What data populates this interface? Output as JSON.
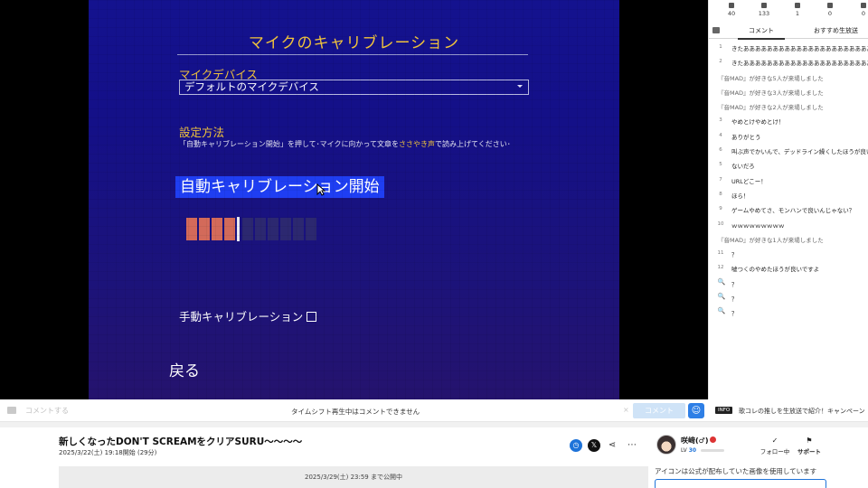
{
  "game": {
    "title": "マイクのキャリブレーション",
    "device_label": "マイクデバイス",
    "device_value": "デフォルトのマイクデバイス",
    "method_label": "設定方法",
    "desc_a": "「自動キャリブレーション開始」を押して･マイクに向かって文章を",
    "desc_hl": "ささやき声",
    "desc_b": "で読み上げてください･",
    "auto_button": "自動キャリブレーション開始",
    "meter_level": 0.4,
    "manual_label": "手動キャリブレーション",
    "back_label": "戻る"
  },
  "comment_bar": {
    "placeholder": "コメントする",
    "notice": "タイムシフト再生中はコメントできません",
    "submit_label": "コメント",
    "clear_label": "×"
  },
  "stats": [
    {
      "icon": "viewers-icon",
      "value": "40"
    },
    {
      "icon": "comments-icon",
      "value": "133"
    },
    {
      "icon": "ad-icon",
      "value": "1"
    },
    {
      "icon": "gift-icon",
      "value": "0"
    },
    {
      "icon": "present-icon",
      "value": "0"
    }
  ],
  "tabs": {
    "comments": "コメント",
    "recommended": "おすすめ生放送"
  },
  "comments": [
    {
      "num": "1",
      "text": "きたあああああああああああああああああああああああああああ"
    },
    {
      "num": "2",
      "text": "きたあああああああああああああああああああああああああああ"
    },
    {
      "num": "",
      "text": "『音MAD』が好きな5人が来場しました",
      "sys": true
    },
    {
      "num": "",
      "text": "『音MAD』が好きな3人が来場しました",
      "sys": true
    },
    {
      "num": "",
      "text": "『音MAD』が好きな2人が来場しました",
      "sys": true
    },
    {
      "num": "3",
      "text": "やめとけやめとけ！"
    },
    {
      "num": "4",
      "text": "ありがとう"
    },
    {
      "num": "6",
      "text": "叫ぶ声でかいんで、デッドライン繰くしたほうが良いで"
    },
    {
      "num": "5",
      "text": "ないだろ"
    },
    {
      "num": "7",
      "text": "URLどこー！"
    },
    {
      "num": "8",
      "text": "ほら！"
    },
    {
      "num": "9",
      "text": "ゲームやめてさ、モンハンで良いんじゃない？"
    },
    {
      "num": "10",
      "text": "ｗｗｗｗｗｗｗｗｗ"
    },
    {
      "num": "",
      "text": "『音MAD』が好きな1人が来場しました",
      "sys": true
    },
    {
      "num": "11",
      "text": "？"
    },
    {
      "num": "12",
      "text": "嘘つくのやめたほうが良いですよ"
    },
    {
      "num": "🔍",
      "text": "？",
      "q": true
    },
    {
      "num": "🔍",
      "text": "？",
      "q": true
    },
    {
      "num": "🔍",
      "text": "？",
      "q": true
    }
  ],
  "promo": {
    "tag": "INFO",
    "text": "歌コレの推しを生放送で紹介！キャンペーン"
  },
  "program": {
    "title": "新しくなったDON'T SCREAMをクリアSURU～～～～",
    "date": "2025/3/22(土) 19:18開始 (29分)",
    "published_until": "2025/3/29(土) 23:59 まで公開中"
  },
  "user": {
    "name": "咲﨑(♂)",
    "level_label": "LV",
    "level": "30",
    "follow_label": "フォロー中",
    "support_label": "サポート",
    "avatar_note": "アイコンは公式が配布していた画像を使用しています"
  }
}
